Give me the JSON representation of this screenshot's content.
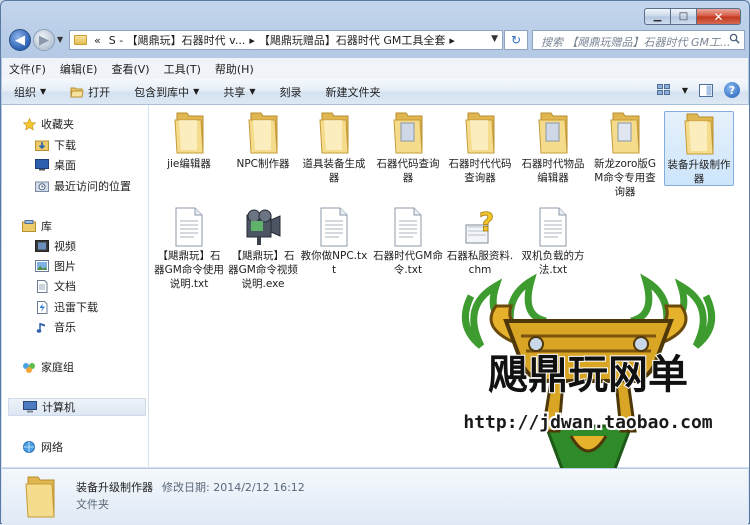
{
  "window": {
    "caption": {
      "min": "▁",
      "max": "□",
      "close": "✕"
    }
  },
  "address": {
    "overflow": "«",
    "segments": [
      "S - 【飓鼎玩】石器时代 v...",
      "【飓鼎玩赠品】石器时代 GM工具全套"
    ],
    "separator": "▸",
    "refresh": "↻"
  },
  "search": {
    "placeholder": "搜索 【飓鼎玩赠品】石器时代 GM工..."
  },
  "menubar": [
    "文件(F)",
    "编辑(E)",
    "查看(V)",
    "工具(T)",
    "帮助(H)"
  ],
  "toolbar": {
    "organize": "组织",
    "open": "打开",
    "include": "包含到库中",
    "share": "共享",
    "burn": "刻录",
    "new_folder": "新建文件夹",
    "help": "?"
  },
  "nav": {
    "favorites": "收藏夹",
    "downloads": "下载",
    "desktop": "桌面",
    "recent": "最近访问的位置",
    "libraries": "库",
    "videos": "视频",
    "pictures": "图片",
    "documents": "文档",
    "thunder": "迅雷下载",
    "music": "音乐",
    "homegroup": "家庭组",
    "computer": "计算机",
    "network": "网络"
  },
  "files": [
    {
      "name": "jie编辑器",
      "icon": "folder-icon"
    },
    {
      "name": "NPC制作器",
      "icon": "folder-icon"
    },
    {
      "name": "道具装备生成器",
      "icon": "folder-icon"
    },
    {
      "name": "石器代码查询器",
      "icon": "folder-icon"
    },
    {
      "name": "石器时代代码查询器",
      "icon": "folder-icon"
    },
    {
      "name": "石器时代物品编辑器",
      "icon": "folder-icon"
    },
    {
      "name": "新龙zoro版GM命令专用查询器",
      "icon": "folder-icon"
    },
    {
      "name": "装备升级制作器",
      "icon": "folder-icon"
    },
    {
      "name": "【飓鼎玩】石器GM命令使用说明.txt",
      "icon": "text-file-icon"
    },
    {
      "name": "【飓鼎玩】石器GM命令视频说明.exe",
      "icon": "exe-file-icon"
    },
    {
      "name": "教你做NPC.txt",
      "icon": "text-file-icon"
    },
    {
      "name": "石器时代GM命令.txt",
      "icon": "text-file-icon"
    },
    {
      "name": "石器私服资料.chm",
      "icon": "chm-file-icon"
    },
    {
      "name": "双机负载的方法.txt",
      "icon": "text-file-icon"
    }
  ],
  "details": {
    "name": "装备升级制作器",
    "modified": "修改日期: 2014/2/12 16:12",
    "type": "文件夹"
  },
  "watermark": {
    "title": "飓鼎玩网单",
    "url": "http://jdwan.taobao.com"
  },
  "colors": {
    "accent": "#3b6fb6",
    "folder": "#eccb6a",
    "watermark_gold": "#e6b12b",
    "watermark_green": "#3e9b2f"
  }
}
